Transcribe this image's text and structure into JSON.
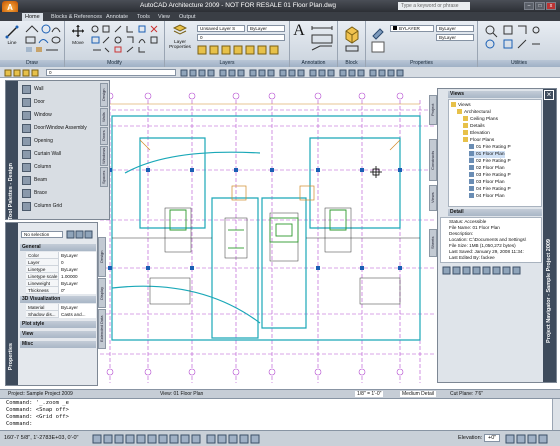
{
  "window": {
    "title": "AutoCAD Architecture 2009 - NOT FOR RESALE 01 Floor Plan.dwg",
    "search_placeholder": "Type a keyword or phrase",
    "app_button": "A"
  },
  "ribbon_tabs": [
    "Home",
    "Blocks & References",
    "Annotate",
    "Tools",
    "View",
    "Output"
  ],
  "ribbon": {
    "panels": [
      "Draw",
      "Modify",
      "Layers",
      "Annotation",
      "Block",
      "Properties",
      "Utilities"
    ],
    "draw_buttons": [
      "Line"
    ],
    "modify_buttons": [
      "Move"
    ],
    "layers_buttons": [
      "Layer Properties"
    ],
    "layer_combo": "Unsaved Layer S",
    "layer_current": "0",
    "layer_bylayer": "ByLayer",
    "annotation_button": "A",
    "props_color": "BYLAYER",
    "props_linetype": "ByLayer",
    "props_lineweight": "ByLayer"
  },
  "toolbar2": {
    "layer_value": "0"
  },
  "tool_palette": {
    "caption": "Tool Palettes - Design",
    "items": [
      "Wall",
      "Door",
      "Window",
      "Door/Window Assembly",
      "Opening",
      "Curtain Wall",
      "Column",
      "Beam",
      "Brace",
      "Column Grid"
    ],
    "side_tabs": [
      "Design",
      "Walls",
      "Doors",
      "Windows",
      "Spaces"
    ]
  },
  "properties": {
    "caption": "Properties",
    "selector": "No selection",
    "sections": {
      "general": "General",
      "viz": "3D Visualization",
      "plot": "Plot style",
      "view": "View",
      "misc": "Misc"
    },
    "general_rows": [
      {
        "k": "Color",
        "v": "ByLayer"
      },
      {
        "k": "Layer",
        "v": "0"
      },
      {
        "k": "Linetype",
        "v": "ByLayer"
      },
      {
        "k": "Linetype scale",
        "v": "1.00000"
      },
      {
        "k": "Lineweight",
        "v": "ByLayer"
      },
      {
        "k": "Thickness",
        "v": "0\""
      }
    ],
    "viz_rows": [
      {
        "k": "Material",
        "v": "ByLayer"
      },
      {
        "k": "Shadow dis...",
        "v": "Casts and..."
      }
    ],
    "side_tabs": [
      "Design",
      "Display",
      "Extended Data"
    ]
  },
  "navigator": {
    "caption": "Project Navigator - Sample Project 2009",
    "views_label": "Views",
    "tree": [
      {
        "label": "Views",
        "level": 0
      },
      {
        "label": "Architectural",
        "level": 1
      },
      {
        "label": "Ceiling Plans",
        "level": 2
      },
      {
        "label": "Details",
        "level": 2
      },
      {
        "label": "Elevation",
        "level": 2
      },
      {
        "label": "Floor Plans",
        "level": 2
      },
      {
        "label": "01 Fire Rating P",
        "level": 3
      },
      {
        "label": "01 Floor Plan",
        "level": 3
      },
      {
        "label": "02 Fire Rating P",
        "level": 3
      },
      {
        "label": "02 Floor Plan",
        "level": 3
      },
      {
        "label": "03 Fire Rating P",
        "level": 3
      },
      {
        "label": "03 Floor Plan",
        "level": 3
      },
      {
        "label": "04 Fire Rating P",
        "level": 3
      },
      {
        "label": "04 Floor Plan",
        "level": 3
      }
    ],
    "side_tabs": [
      "Project",
      "Constructs",
      "Views",
      "Sheets"
    ],
    "detail_label": "Detail",
    "detail_lines": [
      "Status: Accessible",
      "File Name: 01 Floor Plan",
      "Description:",
      "Location: C:\\Documents and Settings\\",
      "File Size: 1MB (1,050,272 bytes)",
      "Last Saved: January 29, 2008 11:34:",
      "Last Edited By: fackee"
    ]
  },
  "drawing_bar": {
    "project": "Project: Sample Project 2009",
    "view": "View: 01 Floor Plan",
    "scale": "1/8\" = 1'-0\"",
    "detail": "Medium Detail",
    "cut_plane": "Cut Plane: 7'6\""
  },
  "command_lines": [
    "Command:  '_.zoom _e",
    "Command:  <Snap off>",
    "Command:  <Grid off>",
    "Command:"
  ],
  "status": {
    "coords": "160'-7 5/8\", 1'-2783E+03, 0'-0\"",
    "elevation_label": "Elevation:",
    "elevation_value": "+0\""
  },
  "colors": {
    "grid_magenta": "#b44bd0",
    "wall_cyan": "#1aa8b8",
    "door_green": "#2e9a2e",
    "dim_orange": "#d08a28",
    "ribbon_blue": "#3e4b5c"
  }
}
